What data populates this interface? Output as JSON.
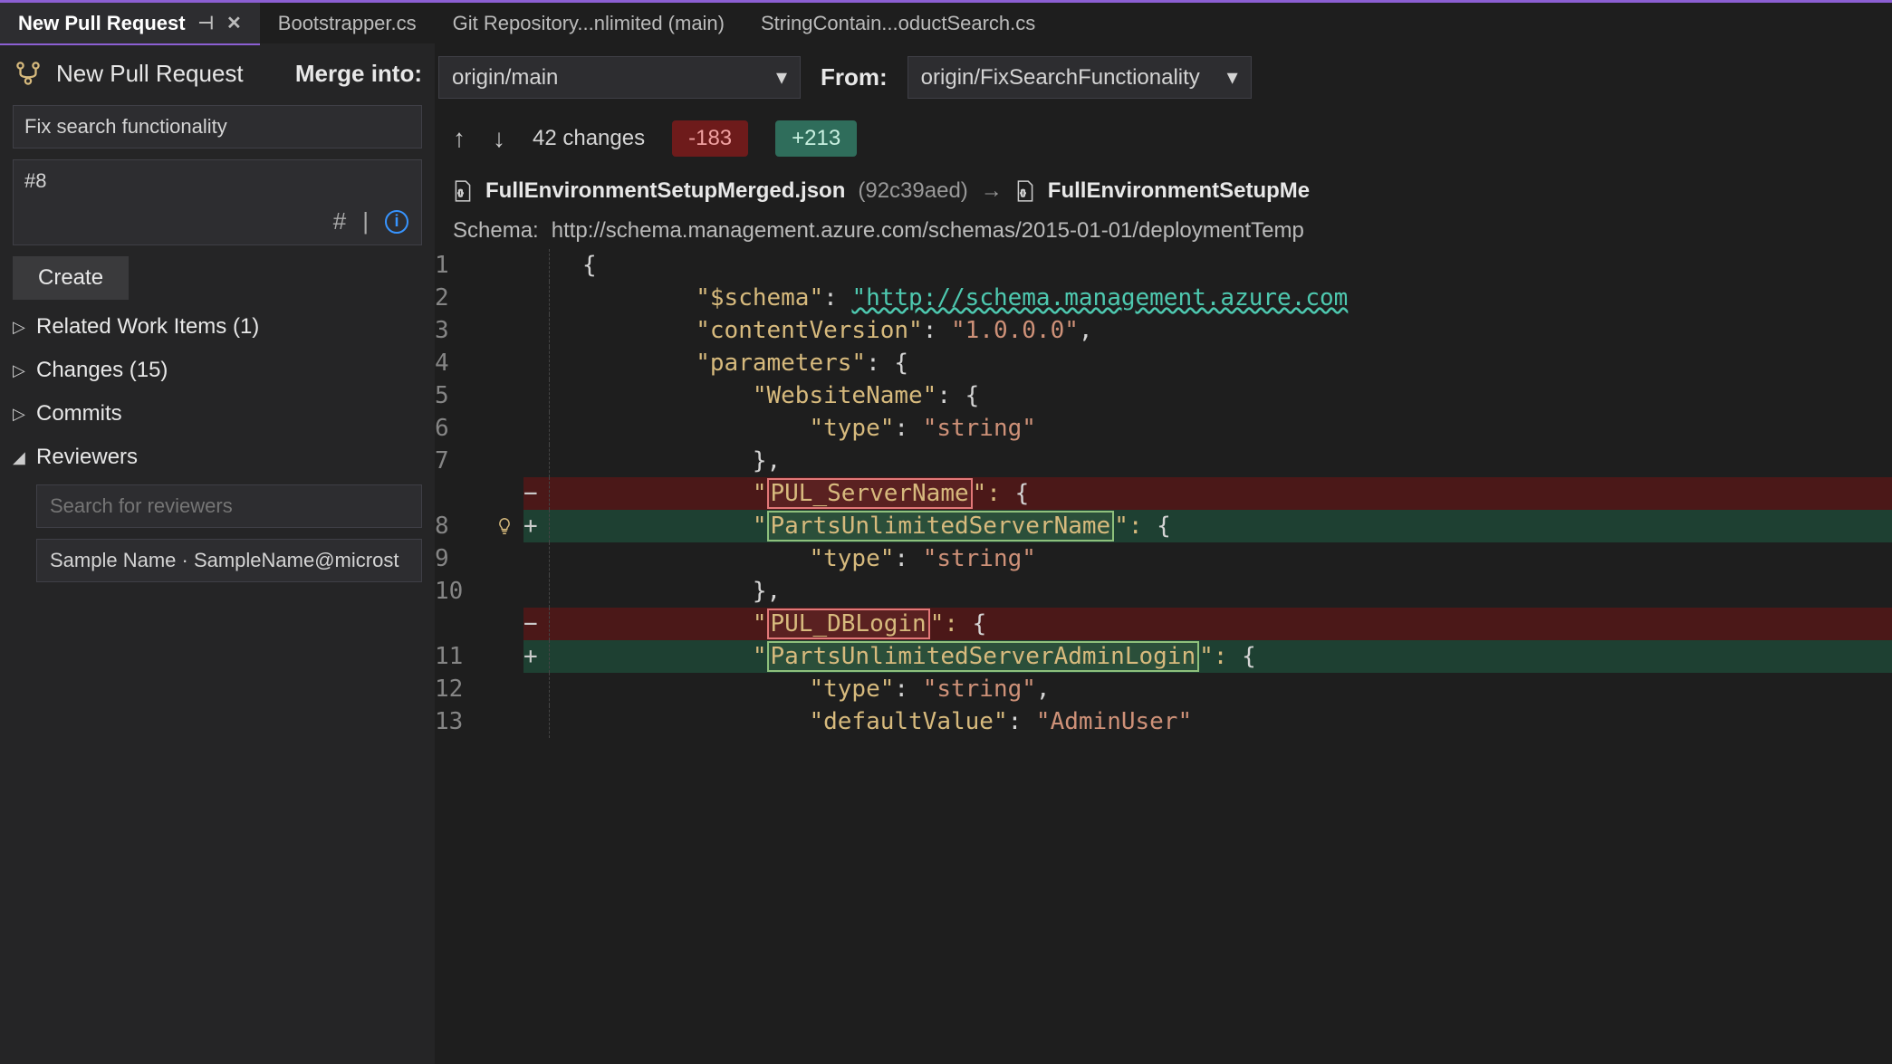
{
  "tabs": [
    {
      "label": "New Pull Request",
      "active": true,
      "pinned": true
    },
    {
      "label": "Bootstrapper.cs",
      "active": false
    },
    {
      "label": "Git Repository...nlimited (main)",
      "active": false
    },
    {
      "label": "StringContain...oductSearch.cs",
      "active": false
    }
  ],
  "left": {
    "title": "New Pull Request",
    "merge_label": "Merge into:",
    "from_label": "From:",
    "title_input": "Fix search functionality",
    "desc_top": "#8",
    "hash_glyph": "#",
    "pipe_glyph": "|",
    "create": "Create",
    "tree": {
      "related": "Related Work Items (1)",
      "changes": "Changes (15)",
      "commits": "Commits",
      "reviewers": "Reviewers"
    },
    "reviewer_search_placeholder": "Search for reviewers",
    "reviewer_item": "Sample Name · SampleName@microst"
  },
  "merge": {
    "into_value": "origin/main",
    "from_value": "origin/FixSearchFunctionality"
  },
  "changes": {
    "count_text": "42 changes",
    "del": "-183",
    "add": "+213"
  },
  "file": {
    "left_name": "FullEnvironmentSetupMerged.json",
    "left_hash": "(92c39aed)",
    "arrow": "→",
    "right_name": "FullEnvironmentSetupMe"
  },
  "schema": {
    "label": "Schema:",
    "value": "http://schema.management.azure.com/schemas/2015-01-01/deploymentTemp"
  },
  "code": {
    "lines": [
      {
        "n": "1",
        "t": "normal",
        "text": "{"
      },
      {
        "n": "2",
        "t": "normal",
        "key": "\"$schema\"",
        "sep": ": ",
        "url": "\"http://schema.management.azure.com"
      },
      {
        "n": "3",
        "t": "normal",
        "key": "\"contentVersion\"",
        "sep": ": ",
        "val": "\"1.0.0.0\"",
        "tail": ","
      },
      {
        "n": "4",
        "t": "normal",
        "key": "\"parameters\"",
        "sep": ": ",
        "tail": "{"
      },
      {
        "n": "5",
        "t": "normal",
        "key": "\"WebsiteName\"",
        "sep": ": ",
        "tail": "{"
      },
      {
        "n": "6",
        "t": "normal",
        "key": "\"type\"",
        "sep": ": ",
        "val": "\"string\""
      },
      {
        "n": "7",
        "t": "normal",
        "tail": "},"
      },
      {
        "n": "",
        "t": "del",
        "box": "PUL_ServerName",
        "sep": "\": ",
        "tail": "{"
      },
      {
        "n": "8",
        "t": "add",
        "box": "PartsUnlimitedServerName",
        "sep": "\": ",
        "tail": "{",
        "bulb": true
      },
      {
        "n": "9",
        "t": "normal",
        "key": "\"type\"",
        "sep": ": ",
        "val": "\"string\""
      },
      {
        "n": "10",
        "t": "normal",
        "tail": "},"
      },
      {
        "n": "",
        "t": "del",
        "box": "PUL_DBLogin",
        "sep": "\": ",
        "tail": "{"
      },
      {
        "n": "11",
        "t": "add",
        "box": "PartsUnlimitedServerAdminLogin",
        "sep": "\": ",
        "tail": "{"
      },
      {
        "n": "12",
        "t": "normal",
        "key": "\"type\"",
        "sep": ": ",
        "val": "\"string\"",
        "tail": ","
      },
      {
        "n": "13",
        "t": "normal",
        "key": "\"defaultValue\"",
        "sep": ": ",
        "val": "\"AdminUser\""
      }
    ]
  }
}
